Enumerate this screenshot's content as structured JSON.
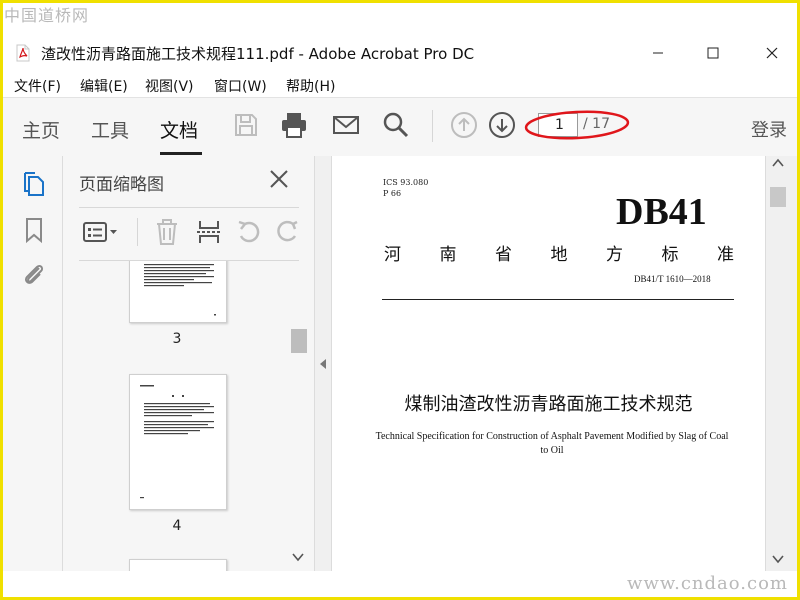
{
  "watermark": {
    "top": "中国道桥网",
    "bottom": "www.cndao.com"
  },
  "window": {
    "title": "渣改性沥青路面施工技术规程111.pdf - Adobe Acrobat Pro DC",
    "icons": [
      "pdf-file-icon",
      "minimize-icon",
      "maximize-icon",
      "close-icon"
    ]
  },
  "menu": [
    "文件(F)",
    "编辑(E)",
    "视图(V)",
    "窗口(W)",
    "帮助(H)"
  ],
  "toolbar": {
    "tabs": [
      "主页",
      "工具",
      "文档"
    ],
    "active_tab": "文档",
    "icons": [
      "save-icon",
      "print-icon",
      "mail-icon",
      "search-icon",
      "previous-page-icon",
      "next-page-icon"
    ],
    "page_current": "1",
    "page_total": "/ 17",
    "login": "登录",
    "annotation_color": "#e0161b"
  },
  "rail": {
    "icons": [
      "page-thumbnails-icon",
      "bookmark-icon",
      "attachment-icon"
    ],
    "accent": "#1a73c8"
  },
  "panel": {
    "title": "页面缩略图",
    "tool_icons": [
      "thumbnail-options-icon",
      "delete-icon",
      "extract-icon",
      "undo-icon",
      "redo-icon"
    ],
    "thumbnails": [
      {
        "label": "3"
      },
      {
        "label": "4"
      }
    ]
  },
  "document": {
    "ics": "ICS  93.080",
    "p": "P  66",
    "code": "DB41",
    "province_chars": [
      "河",
      "南",
      "省",
      "地",
      "方",
      "标",
      "准"
    ],
    "std_number": "DB41/T 1610—2018",
    "title_cn": "煤制油渣改性沥青路面施工技术规范",
    "title_en": "Technical Specification for Construction of Asphalt Pavement Modified by Slag of Coal to Oil"
  }
}
